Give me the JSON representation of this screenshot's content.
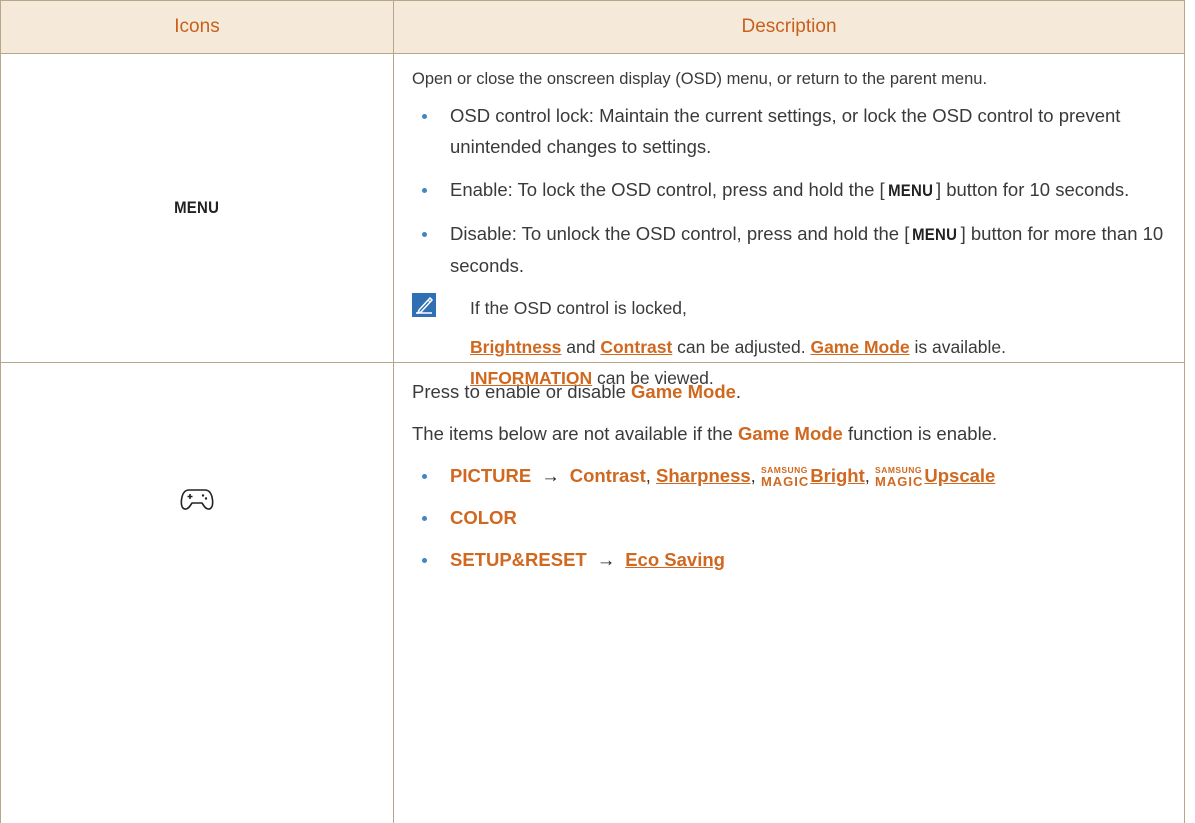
{
  "header": {
    "icons": "Icons",
    "description": "Description"
  },
  "menu_row": {
    "icon_label": "MENU",
    "intro": "Open or close the onscreen display (OSD) menu, or return to the parent menu.",
    "bullet1": "OSD control lock: Maintain the current settings, or lock the OSD control to prevent unintended changes to settings.",
    "bullet2_pre": "Enable: To lock the OSD control, press and hold the [",
    "bullet2_key": "MENU",
    "bullet2_post": "] button for 10 seconds.",
    "bullet3_pre": "Disable: To unlock the OSD control, press and hold the [",
    "bullet3_key": "MENU",
    "bullet3_post": "] button for more than 10 seconds.",
    "note_line1": "If the OSD control is locked,",
    "note_brightness": "Brightness",
    "note_and": " and ",
    "note_contrast": "Contrast",
    "note_mid": " can be adjusted. ",
    "note_game_mode": "Game Mode",
    "note_available": " is available.",
    "note_information": "INFORMATION",
    "note_viewed": " can be viewed."
  },
  "game_row": {
    "icon_name": "gamepad-icon",
    "line1_pre": "Press to enable or disable ",
    "line1_mode": "Game Mode",
    "line1_post": ".",
    "line2_pre": "The items below are not available if the ",
    "line2_mode": "Game Mode",
    "line2_post": " function is enable.",
    "picture": "PICTURE",
    "arrow": "→",
    "contrast": "Contrast",
    "comma": ",",
    "sharpness": "Sharpness",
    "samsung": "SAMSUNG",
    "magic": "MAGIC",
    "bright": "Bright",
    "upscale": "Upscale",
    "color": "COLOR",
    "setup": "SETUP&RESET",
    "eco": "Eco Saving"
  },
  "colors": {
    "accent": "#d0681f",
    "header_bg": "#f5eada",
    "border": "#b7a58c",
    "bullet": "#3f86c4"
  }
}
